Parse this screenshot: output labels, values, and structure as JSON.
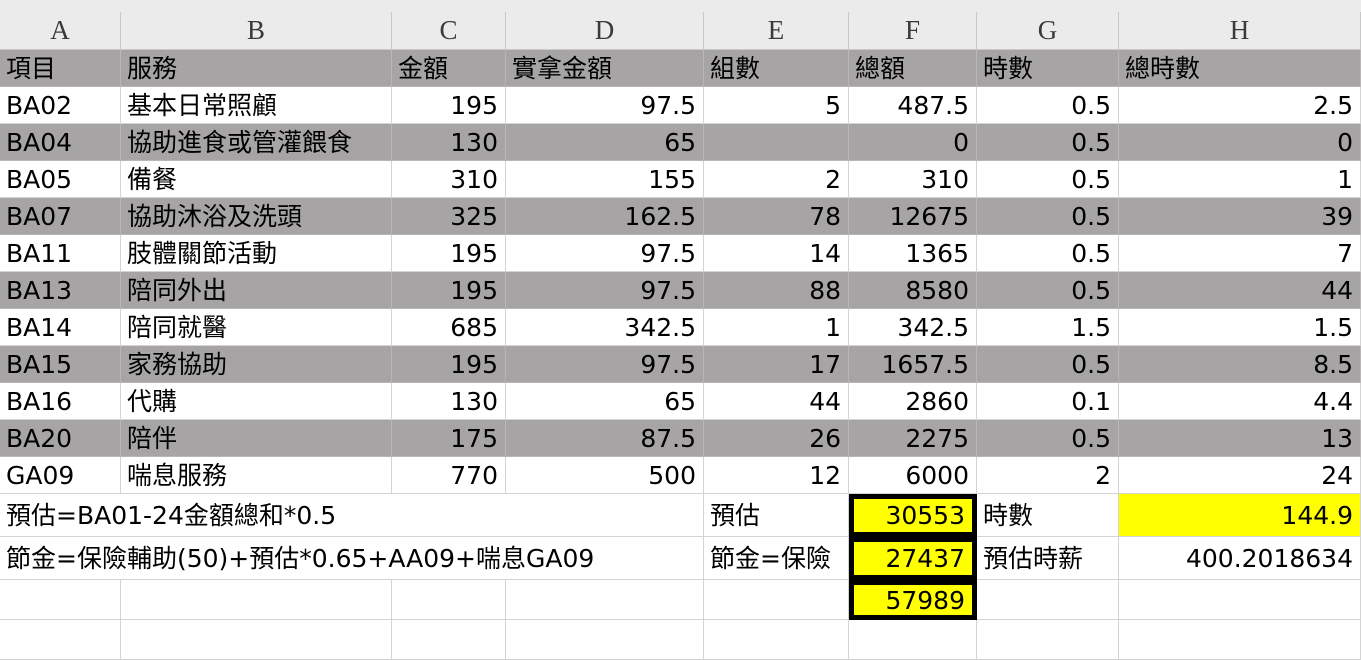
{
  "columns": [
    "A",
    "B",
    "C",
    "D",
    "E",
    "F",
    "G",
    "H"
  ],
  "header_row": [
    "項目",
    "服務",
    "金額",
    "實拿金額",
    "組數",
    "總額",
    "時數",
    "總時數"
  ],
  "rows": [
    [
      "BA02",
      "基本日常照顧",
      "195",
      "97.5",
      "5",
      "487.5",
      "0.5",
      "2.5"
    ],
    [
      "BA04",
      "協助進食或管灌餵食",
      "130",
      "65",
      "",
      "0",
      "0.5",
      "0"
    ],
    [
      "BA05",
      "備餐",
      "310",
      "155",
      "2",
      "310",
      "0.5",
      "1"
    ],
    [
      "BA07",
      "協助沐浴及洗頭",
      "325",
      "162.5",
      "78",
      "12675",
      "0.5",
      "39"
    ],
    [
      "BA11",
      "肢體關節活動",
      "195",
      "97.5",
      "14",
      "1365",
      "0.5",
      "7"
    ],
    [
      "BA13",
      "陪同外出",
      "195",
      "97.5",
      "88",
      "8580",
      "0.5",
      "44"
    ],
    [
      "BA14",
      "陪同就醫",
      "685",
      "342.5",
      "1",
      "342.5",
      "1.5",
      "1.5"
    ],
    [
      "BA15",
      "家務協助",
      "195",
      "97.5",
      "17",
      "1657.5",
      "0.5",
      "8.5"
    ],
    [
      "BA16",
      "代購",
      "130",
      "65",
      "44",
      "2860",
      "0.1",
      "4.4"
    ],
    [
      "BA20",
      "陪伴",
      "175",
      "87.5",
      "26",
      "2275",
      "0.5",
      "13"
    ],
    [
      "GA09",
      "喘息服務",
      "770",
      "500",
      "12",
      "6000",
      "2",
      "24"
    ]
  ],
  "summary": {
    "estimate_note": "預估=BA01-24金額總和*0.5",
    "estimate_label": "預估",
    "estimate_value": "30553",
    "hours_label": "時數",
    "hours_value": "144.9",
    "savings_note": "節金=保險輔助(50)+預估*0.65+AA09+喘息GA09",
    "savings_label": "節金=保險",
    "savings_value": "27437",
    "hourly_label": "預估時薪",
    "hourly_value": "400.2018634",
    "total_value": "57989"
  },
  "colors": {
    "stripe_gray": "#a6a4a4",
    "highlight_yellow": "#ffff00",
    "header_bg": "#ebebeb"
  }
}
